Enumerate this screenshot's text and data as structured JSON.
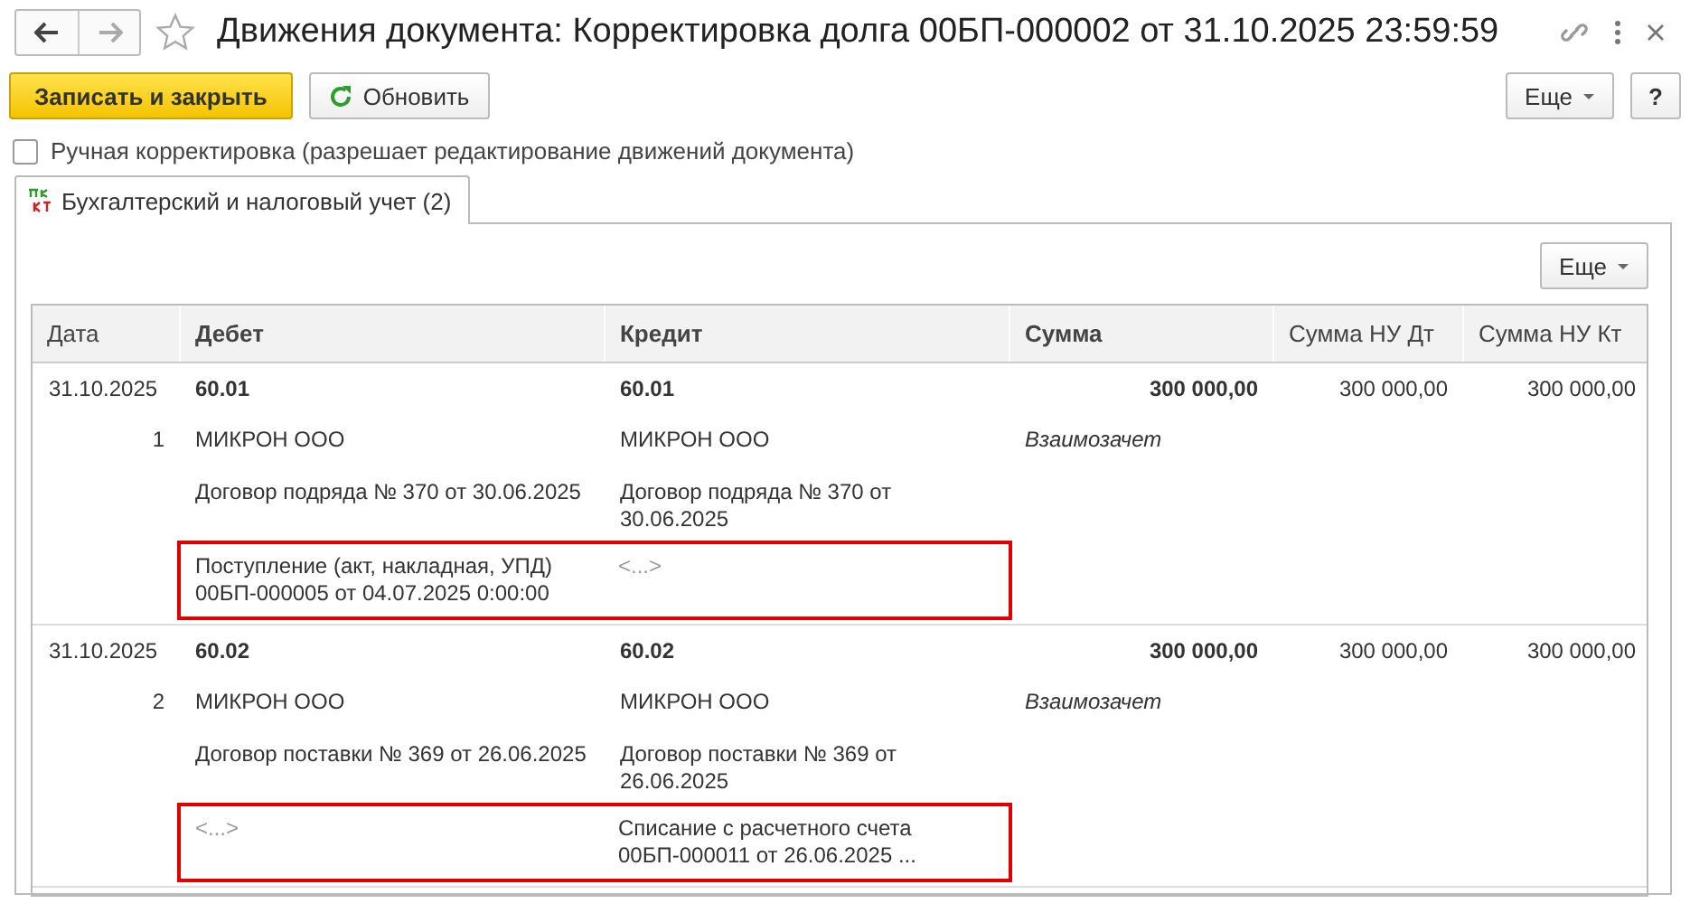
{
  "window": {
    "title": "Движения документа: Корректировка долга 00БП-000002 от 31.10.2025 23:59:59"
  },
  "toolbar": {
    "buttons": [
      {
        "label": "Записать и закрыть",
        "kind": "primary"
      },
      {
        "label": "Обновить",
        "kind": "refresh"
      }
    ],
    "more": "Еще",
    "help": "?"
  },
  "manual_edit": {
    "label": "Ручная корректировка (разрешает редактирование движений документа)",
    "checked": false
  },
  "tabs": [
    {
      "label": "Бухгалтерский и налоговый учет (2)",
      "selected": true
    }
  ],
  "table_more": "Еще",
  "table": {
    "columns": [
      "Дата",
      "Дебет",
      "Кредит",
      "Сумма",
      "Сумма НУ Дт",
      "Сумма НУ Кт"
    ],
    "rows": [
      {
        "date": "31.10.2025",
        "number": "1",
        "debit": {
          "account": "60.01",
          "counterparty": "МИКРОН ООО",
          "contract": "Договор подряда № 370 от 30.06.2025",
          "document": "Поступление (акт, накладная, УПД) 00БП-000005 от 04.07.2025 0:00:00",
          "document_empty": false
        },
        "credit": {
          "account": "60.01",
          "counterparty": "МИКРОН ООО",
          "contract": "Договор подряда № 370 от 30.06.2025",
          "document": "<...>",
          "document_empty": true
        },
        "amount": "300 000,00",
        "content": "Взаимозачет",
        "amount_nu_dt": "300 000,00",
        "amount_nu_kt": "300 000,00",
        "highlighted": true
      },
      {
        "date": "31.10.2025",
        "number": "2",
        "debit": {
          "account": "60.02",
          "counterparty": "МИКРОН ООО",
          "contract": "Договор поставки № 369 от 26.06.2025",
          "document": "<...>",
          "document_empty": true
        },
        "credit": {
          "account": "60.02",
          "counterparty": "МИКРОН ООО",
          "contract": "Договор поставки № 369 от 26.06.2025",
          "document": "Списание с расчетного счета 00БП-000011 от 26.06.2025 ...",
          "document_empty": false
        },
        "amount": "300 000,00",
        "content": "Взаимозачет",
        "amount_nu_dt": "300 000,00",
        "amount_nu_kt": "300 000,00",
        "highlighted": true
      }
    ]
  }
}
